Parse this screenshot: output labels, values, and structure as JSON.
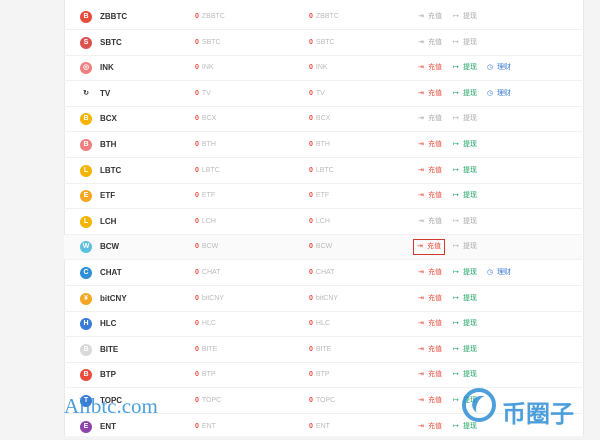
{
  "labels": {
    "deposit": "充值",
    "withdraw": "提现",
    "finance": "理财"
  },
  "colors": {
    "deposit_active": "#e84c3d",
    "withdraw_active": "#1aa260",
    "disabled": "#aaaaaa",
    "finance": "#3a7bd5",
    "highlight_border": "#d0392f"
  },
  "rows": [
    {
      "symbol": "ZBBTC",
      "amount": "0",
      "unit": "ZBBTC",
      "active": false,
      "finance": false,
      "icon_color": "#e84c3d",
      "icon_glyph": "B"
    },
    {
      "symbol": "SBTC",
      "amount": "0",
      "unit": "SBTC",
      "active": false,
      "finance": false,
      "icon_color": "#d9534f",
      "icon_glyph": "S"
    },
    {
      "symbol": "INK",
      "amount": "0",
      "unit": "INK",
      "active": true,
      "finance": true,
      "icon_color": "#f08080",
      "icon_glyph": "◎"
    },
    {
      "symbol": "TV",
      "amount": "0",
      "unit": "TV",
      "active": true,
      "finance": true,
      "icon_color": "#ffffff",
      "icon_glyph": "↻"
    },
    {
      "symbol": "BCX",
      "amount": "0",
      "unit": "BCX",
      "active": false,
      "finance": false,
      "icon_color": "#f5b400",
      "icon_glyph": "B"
    },
    {
      "symbol": "BTH",
      "amount": "0",
      "unit": "BTH",
      "active": true,
      "finance": false,
      "icon_color": "#f08080",
      "icon_glyph": "B"
    },
    {
      "symbol": "LBTC",
      "amount": "0",
      "unit": "LBTC",
      "active": true,
      "finance": false,
      "icon_color": "#f5b400",
      "icon_glyph": "L"
    },
    {
      "symbol": "ETF",
      "amount": "0",
      "unit": "ETF",
      "active": true,
      "finance": false,
      "icon_color": "#f5a623",
      "icon_glyph": "E"
    },
    {
      "symbol": "LCH",
      "amount": "0",
      "unit": "LCH",
      "active": false,
      "finance": false,
      "icon_color": "#f5b400",
      "icon_glyph": "L"
    },
    {
      "symbol": "BCW",
      "amount": "0",
      "unit": "BCW",
      "active": true,
      "finance": false,
      "icon_color": "#5bc0de",
      "icon_glyph": "W",
      "highlight_deposit": true,
      "withdraw_disabled": true
    },
    {
      "symbol": "CHAT",
      "amount": "0",
      "unit": "CHAT",
      "active": true,
      "finance": true,
      "icon_color": "#2f8fd6",
      "icon_glyph": "C"
    },
    {
      "symbol": "bitCNY",
      "amount": "0",
      "unit": "bitCNY",
      "active": true,
      "finance": false,
      "icon_color": "#f5a623",
      "icon_glyph": "¥"
    },
    {
      "symbol": "HLC",
      "amount": "0",
      "unit": "HLC",
      "active": true,
      "finance": false,
      "icon_color": "#3a7bd5",
      "icon_glyph": "H"
    },
    {
      "symbol": "BITE",
      "amount": "0",
      "unit": "BITE",
      "active": true,
      "finance": false,
      "icon_color": "#d9d9d9",
      "icon_glyph": "B"
    },
    {
      "symbol": "BTP",
      "amount": "0",
      "unit": "BTP",
      "active": true,
      "finance": false,
      "icon_color": "#e84c3d",
      "icon_glyph": "B"
    },
    {
      "symbol": "TOPC",
      "amount": "0",
      "unit": "TOPC",
      "active": true,
      "finance": false,
      "icon_color": "#3a7bd5",
      "icon_glyph": "T"
    },
    {
      "symbol": "ENT",
      "amount": "0",
      "unit": "ENT",
      "active": true,
      "finance": false,
      "icon_color": "#8e44ad",
      "icon_glyph": "E"
    }
  ],
  "watermark": {
    "left_text": "Alibtc.com",
    "right_text": "币圈子"
  }
}
